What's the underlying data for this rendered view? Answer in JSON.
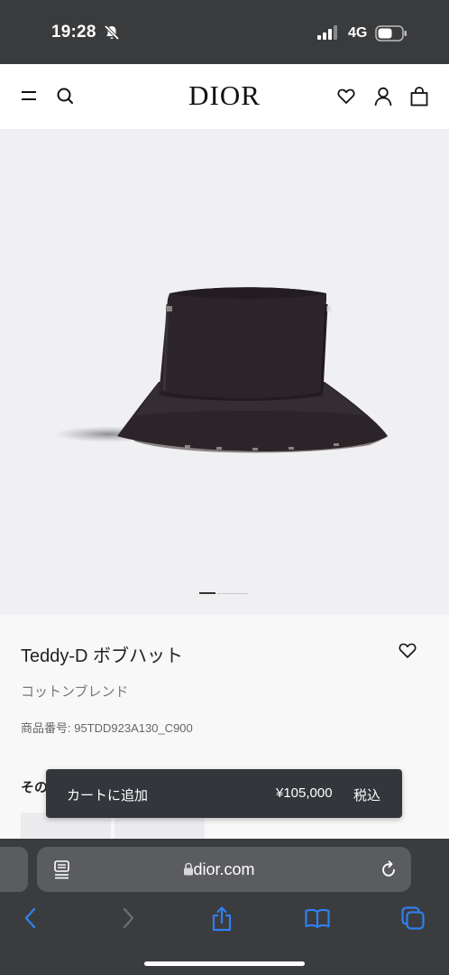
{
  "status_bar": {
    "time": "19:28",
    "network": "4G"
  },
  "header": {
    "logo": "DIOR"
  },
  "product": {
    "title": "Teddy-D ボブハット",
    "subtitle": "コットンブレンド",
    "reference": "商品番号: 95TDD923A130_C900",
    "section_cut": "その"
  },
  "cart_bar": {
    "label": "カートに追加",
    "price": "¥105,000",
    "tax": "税込"
  },
  "browser": {
    "domain": "dior.com"
  },
  "colors": {
    "status_bg": "#3a3b3d",
    "hero_bg": "#f0f0f3",
    "hat": "#2b2428",
    "cart_bar_bg": "#33363b",
    "browser_bg": "#3b3c3f",
    "browser_accent": "#2f80ed"
  },
  "icons": [
    "bell-off-icon",
    "signal-icon",
    "battery-icon",
    "menu-icon",
    "search-icon",
    "heart-icon",
    "account-icon",
    "bag-icon",
    "reader-icon",
    "lock-icon",
    "reload-icon",
    "back-icon",
    "forward-icon",
    "share-icon",
    "bookmarks-icon",
    "tabs-icon"
  ]
}
